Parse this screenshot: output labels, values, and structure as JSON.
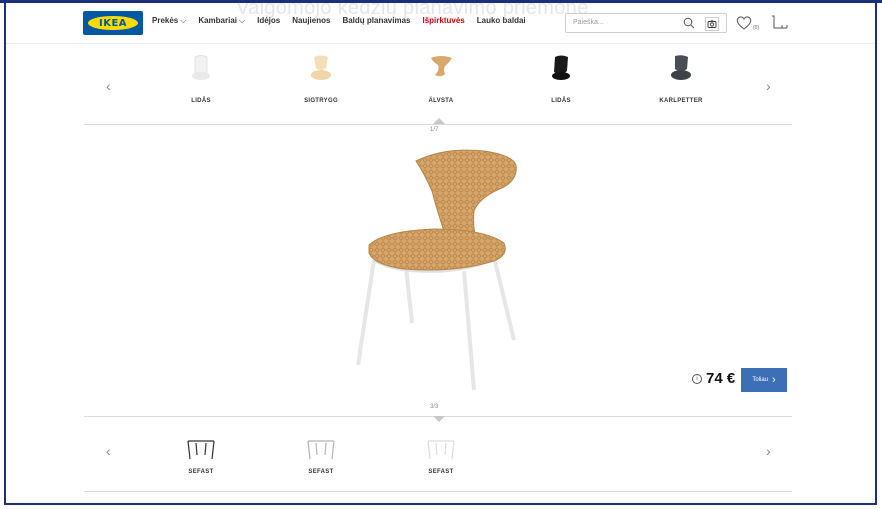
{
  "header": {
    "ghost_title": "Valgomojo kėdžių planavimo priemonė",
    "logo_text": "IKEA",
    "nav": [
      {
        "label": "Prekės",
        "chevron": "⌵"
      },
      {
        "label": "Kambariai",
        "chevron": "⌵"
      },
      {
        "label": "Idėjos"
      },
      {
        "label": "Naujienos"
      },
      {
        "label": "Baldų planavimas"
      },
      {
        "label": "Išpirktuvės",
        "highlight": true
      },
      {
        "label": "Lauko baldai"
      }
    ],
    "search_placeholder": "Paieška...",
    "favorites_count": "(0)"
  },
  "seat_carousel": {
    "prev": "‹",
    "next": "›",
    "items": [
      {
        "label": "LIDÅS",
        "color": "#f2f2f2"
      },
      {
        "label": "SIGTRYGG",
        "color": "#f3deb8"
      },
      {
        "label": "ÄLVSTA",
        "color": "#d9a86a"
      },
      {
        "label": "LIDÅS",
        "color": "#1a1a1a"
      },
      {
        "label": "KARLPETTER",
        "color": "#4a4d55"
      }
    ],
    "counter": "1/7"
  },
  "product": {
    "price": "74 €",
    "info_symbol": "i",
    "next_label": "Toliau",
    "next_chevron": "›"
  },
  "frame_carousel": {
    "prev": "‹",
    "next": "›",
    "counter": "3/3",
    "items": [
      {
        "label": "SEFAST",
        "color": "#333333"
      },
      {
        "label": "SEFAST",
        "color": "#b5b5b5"
      },
      {
        "label": "SEFAST",
        "color": "#dddddd"
      }
    ]
  }
}
